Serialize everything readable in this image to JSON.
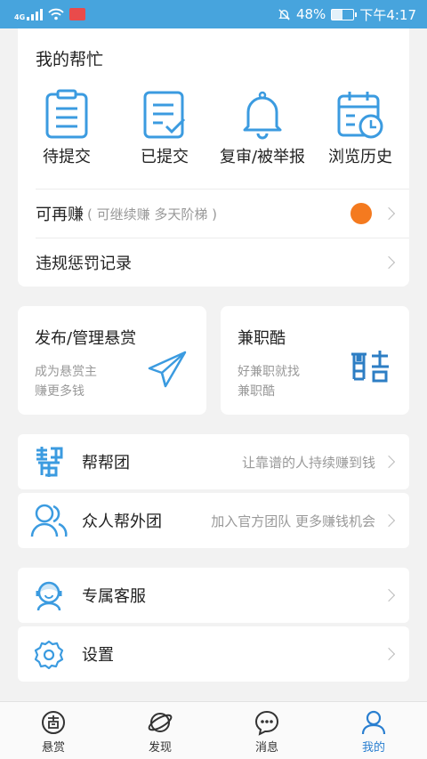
{
  "status_bar": {
    "network": "4G",
    "battery": "48%",
    "battery_level": 0.48,
    "time": "下午4:17"
  },
  "my_help": {
    "title": "我的帮忙",
    "items": [
      {
        "label": "待提交",
        "icon": "clipboard-list-icon"
      },
      {
        "label": "已提交",
        "icon": "document-check-icon"
      },
      {
        "label": "复审/被举报",
        "icon": "bell-icon"
      },
      {
        "label": "浏览历史",
        "icon": "calendar-clock-icon"
      }
    ],
    "earn_again": {
      "title": "可再赚",
      "subtitle": "( 可继续赚 多天阶梯 )"
    },
    "violation": {
      "title": "违规惩罚记录"
    }
  },
  "publish": {
    "title": "发布/管理悬赏",
    "desc": "成为悬赏主\n赚更多钱",
    "icon": "paper-plane-icon"
  },
  "jianzhiku": {
    "title": "兼职酷",
    "desc": "好兼职就找\n兼职酷",
    "icon": "jianzhiku-logo"
  },
  "list": [
    {
      "title": "帮帮团",
      "right": "让靠谱的人持续赚到钱",
      "icon": "bang-logo-icon"
    },
    {
      "title": "众人帮外团",
      "right": "加入官方团队 更多赚钱机会",
      "icon": "users-icon"
    },
    {
      "title": "专属客服",
      "right": "",
      "icon": "customer-service-icon"
    },
    {
      "title": "设置",
      "right": "",
      "icon": "gear-icon"
    }
  ],
  "tabs": [
    {
      "label": "悬赏",
      "icon": "reward-icon",
      "active": false
    },
    {
      "label": "发现",
      "icon": "planet-icon",
      "active": false
    },
    {
      "label": "消息",
      "icon": "chat-bubble-icon",
      "active": false
    },
    {
      "label": "我的",
      "icon": "user-icon",
      "active": true
    }
  ],
  "colors": {
    "accent": "#3b9be0",
    "status_bar": "#47a4dd",
    "dot": "#f47a1f",
    "active_tab": "#2a7fd0"
  }
}
